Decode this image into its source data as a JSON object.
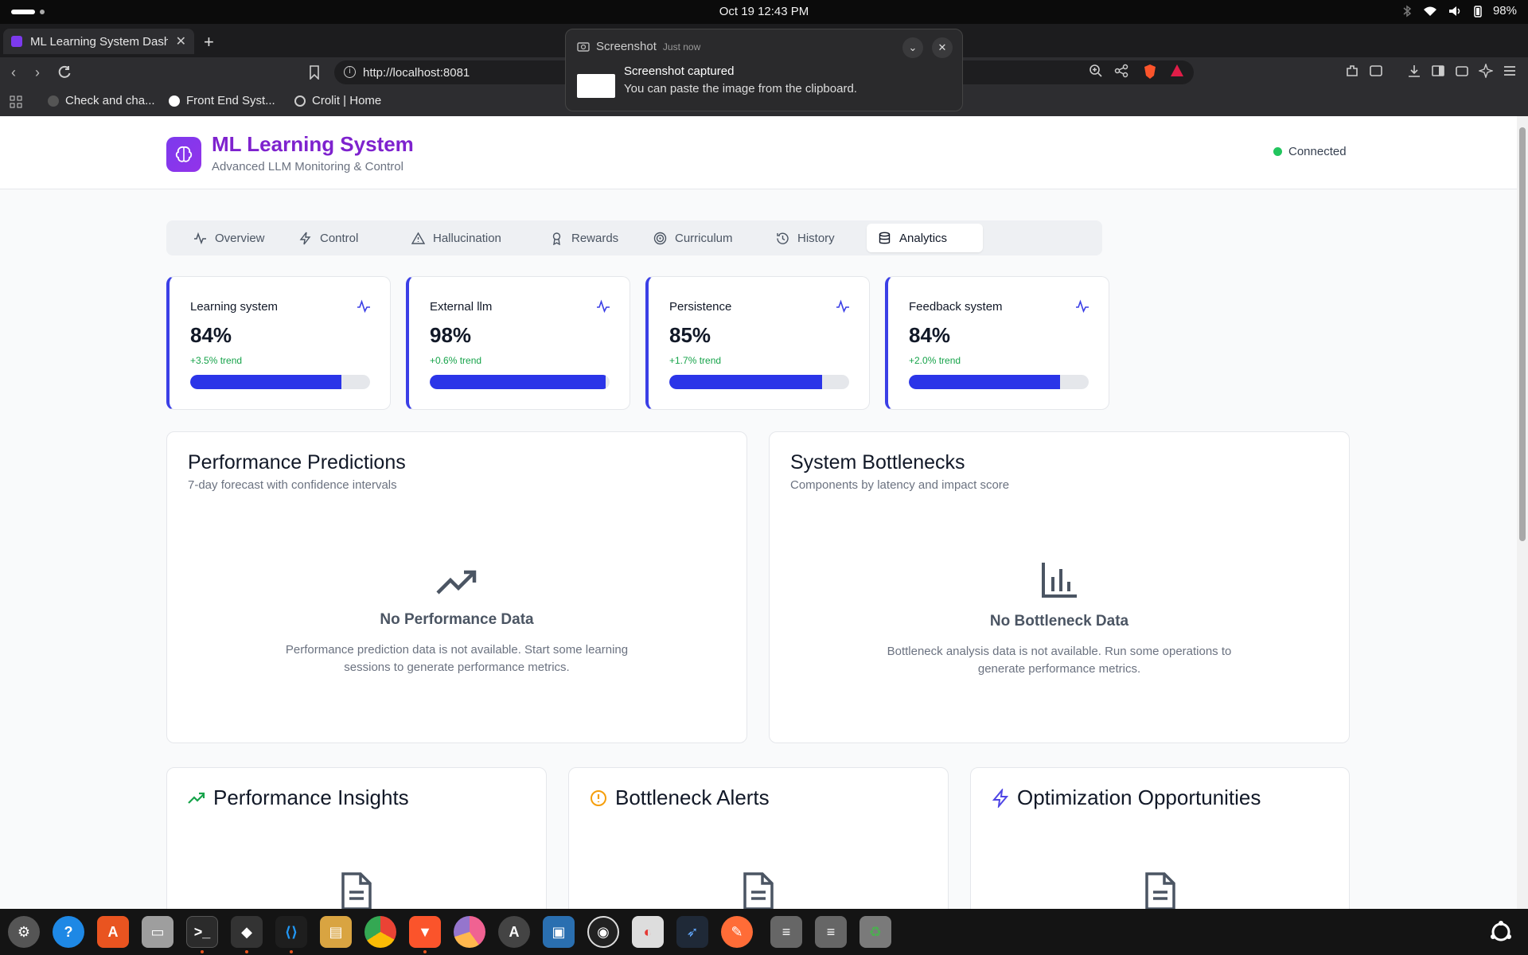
{
  "system_bar": {
    "datetime": "Oct 19  12:43 PM",
    "battery": "98%"
  },
  "browser": {
    "tab_title": "ML Learning System Dashb",
    "url": "http://localhost:8081",
    "bookmarks": [
      "Check and cha...",
      "Front End Syst...",
      "Crolit | Home"
    ]
  },
  "notification": {
    "app": "Screenshot",
    "time": "Just now",
    "title": "Screenshot captured",
    "body": "You can paste the image from the clipboard."
  },
  "header": {
    "title": "ML Learning System",
    "subtitle": "Advanced LLM Monitoring & Control",
    "status": "Connected",
    "status_color": "#22c55e"
  },
  "tabs": [
    {
      "label": "Overview",
      "icon": "activity-icon"
    },
    {
      "label": "Control",
      "icon": "zap-icon"
    },
    {
      "label": "Hallucination",
      "icon": "alert-triangle-icon"
    },
    {
      "label": "Rewards",
      "icon": "award-icon"
    },
    {
      "label": "Curriculum",
      "icon": "target-icon"
    },
    {
      "label": "History",
      "icon": "history-icon"
    },
    {
      "label": "Analytics",
      "icon": "database-icon",
      "active": true
    }
  ],
  "metrics": [
    {
      "label": "Learning system",
      "value": "84%",
      "trend": "+3.5% trend",
      "progress": 0.84
    },
    {
      "label": "External llm",
      "value": "98%",
      "trend": "+0.6% trend",
      "progress": 0.98
    },
    {
      "label": "Persistence",
      "value": "85%",
      "trend": "+1.7% trend",
      "progress": 0.85
    },
    {
      "label": "Feedback system",
      "value": "84%",
      "trend": "+2.0% trend",
      "progress": 0.84
    }
  ],
  "panels": {
    "predictions": {
      "title": "Performance Predictions",
      "subtitle": "7-day forecast with confidence intervals",
      "empty_title": "No Performance Data",
      "empty_desc": "Performance prediction data is not available. Start some learning sessions to generate performance metrics."
    },
    "bottlenecks": {
      "title": "System Bottlenecks",
      "subtitle": "Components by latency and impact score",
      "empty_title": "No Bottleneck Data",
      "empty_desc": "Bottleneck analysis data is not available. Run some operations to generate performance metrics."
    }
  },
  "small_panels": [
    {
      "title": "Performance Insights",
      "icon": "trending-up-icon",
      "icon_color": "#16a34a"
    },
    {
      "title": "Bottleneck Alerts",
      "icon": "alert-circle-icon",
      "icon_color": "#f59e0b"
    },
    {
      "title": "Optimization Opportunities",
      "icon": "zap-icon",
      "icon_color": "#4f46e5"
    }
  ],
  "colors": {
    "accent": "#7e22ce",
    "progress": "#2b35e8",
    "trend": "#16a34a"
  }
}
